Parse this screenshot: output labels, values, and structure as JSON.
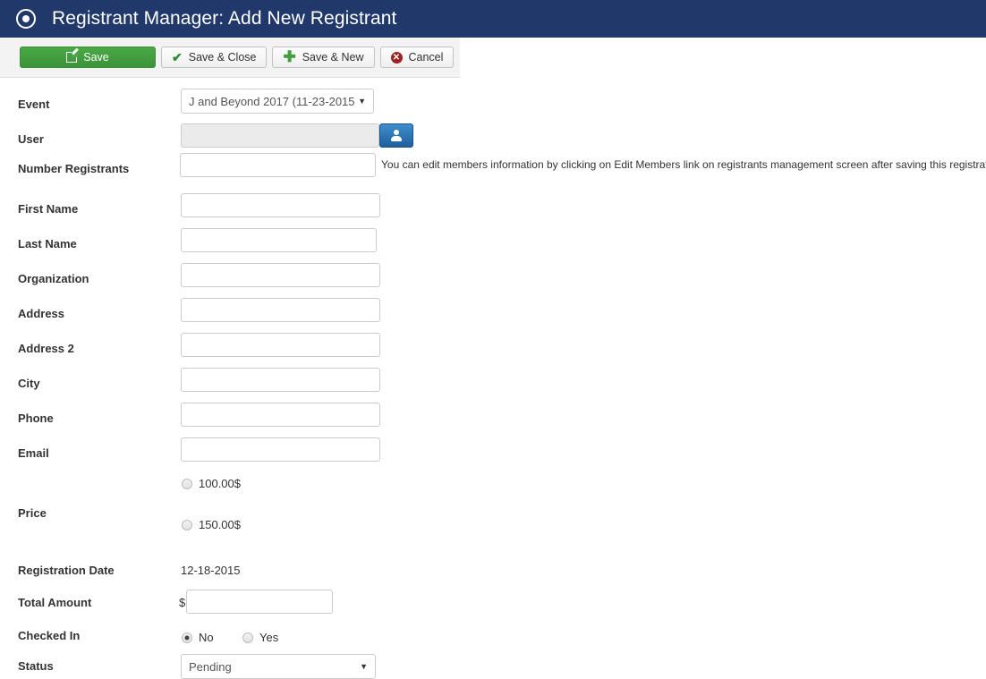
{
  "titlebar": {
    "icon": "target-circle-icon",
    "title": "Registrant Manager: Add New Registrant"
  },
  "toolbar": {
    "save_label": "Save",
    "save_close_label": "Save & Close",
    "save_new_label": "Save & New",
    "cancel_label": "Cancel",
    "colors": {
      "save_green": "#3c9339",
      "check_green": "#2e8b2e",
      "plus_green": "#3fa03c",
      "cancel_red": "#9d2121",
      "header_blue": "#21386b"
    }
  },
  "form": {
    "event": {
      "label": "Event",
      "value": "J and Beyond 2017 (11-23-2015"
    },
    "user": {
      "label": "User",
      "value": "",
      "placeholder": "",
      "picker_icon": "person-icon"
    },
    "number_registrants": {
      "label": "Number Registrants",
      "value": "",
      "help": "You can edit members information by clicking on Edit Members link on registrants management screen after saving this registration record"
    },
    "first_name": {
      "label": "First Name",
      "value": ""
    },
    "last_name": {
      "label": "Last Name",
      "value": ""
    },
    "organization": {
      "label": "Organization",
      "value": ""
    },
    "address": {
      "label": "Address",
      "value": ""
    },
    "address2": {
      "label": "Address 2",
      "value": ""
    },
    "city": {
      "label": "City",
      "value": ""
    },
    "phone": {
      "label": "Phone",
      "value": ""
    },
    "email": {
      "label": "Email",
      "value": ""
    },
    "price": {
      "label": "Price",
      "options": [
        {
          "label": "100.00$",
          "selected": false
        },
        {
          "label": "150.00$",
          "selected": false
        }
      ]
    },
    "registration_date": {
      "label": "Registration Date",
      "value": "12-18-2015"
    },
    "total_amount": {
      "label": "Total Amount",
      "currency": "$",
      "value": ""
    },
    "checked_in": {
      "label": "Checked In",
      "options": [
        {
          "label": "No",
          "selected": true
        },
        {
          "label": "Yes",
          "selected": false
        }
      ]
    },
    "status": {
      "label": "Status",
      "value": "Pending"
    }
  }
}
